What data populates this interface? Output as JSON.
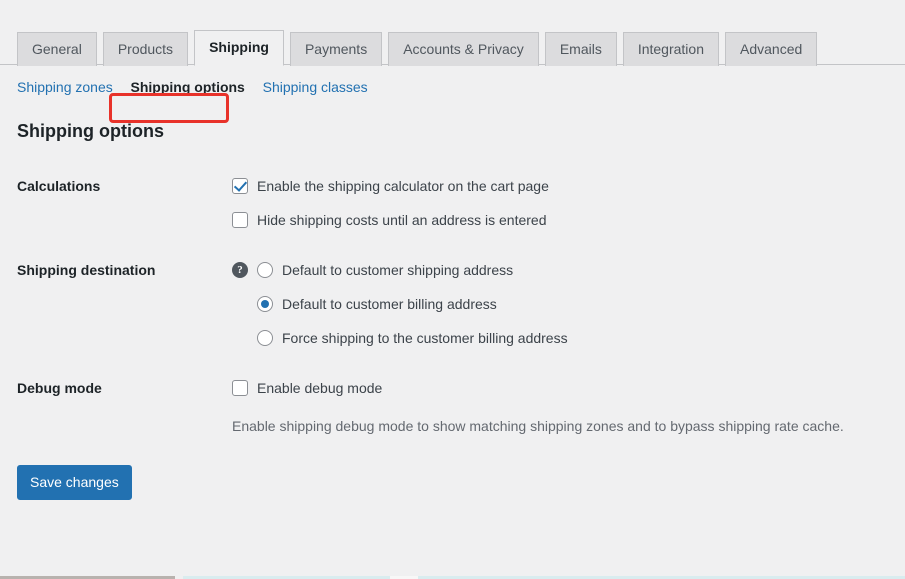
{
  "tabs": [
    {
      "label": "General",
      "active": false
    },
    {
      "label": "Products",
      "active": false
    },
    {
      "label": "Shipping",
      "active": true
    },
    {
      "label": "Payments",
      "active": false
    },
    {
      "label": "Accounts & Privacy",
      "active": false
    },
    {
      "label": "Emails",
      "active": false
    },
    {
      "label": "Integration",
      "active": false
    },
    {
      "label": "Advanced",
      "active": false
    }
  ],
  "subnav": {
    "zones": "Shipping zones",
    "options": "Shipping options",
    "classes": "Shipping classes",
    "separator": "  "
  },
  "page_title": "Shipping options",
  "sections": {
    "calculations": {
      "label": "Calculations",
      "options": [
        {
          "label": "Enable the shipping calculator on the cart page",
          "checked": true
        },
        {
          "label": "Hide shipping costs until an address is entered",
          "checked": false
        }
      ]
    },
    "shipping_destination": {
      "label": "Shipping destination",
      "help_icon": "help-icon",
      "help_glyph": "?",
      "options": [
        {
          "label": "Default to customer shipping address",
          "selected": false
        },
        {
          "label": "Default to customer billing address",
          "selected": true
        },
        {
          "label": "Force shipping to the customer billing address",
          "selected": false
        }
      ]
    },
    "debug_mode": {
      "label": "Debug mode",
      "options": [
        {
          "label": "Enable debug mode",
          "checked": false
        }
      ],
      "description": "Enable shipping debug mode to show matching shipping zones and to bypass shipping rate cache."
    }
  },
  "submit": {
    "save_label": "Save changes"
  },
  "colors": {
    "accent": "#2271b1",
    "annotation": "#e8322a",
    "background": "#f0f0f1",
    "tab_inactive": "#dcdcde",
    "text": "#1d2327",
    "muted_text": "#646970"
  }
}
